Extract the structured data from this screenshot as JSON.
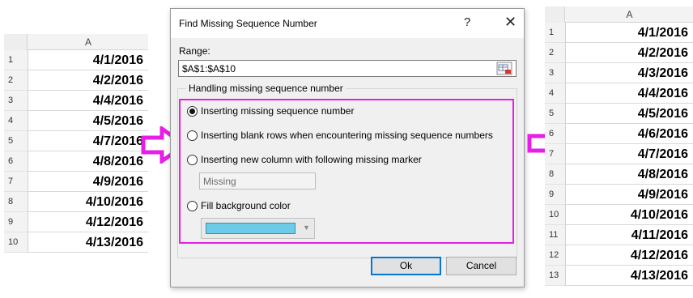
{
  "left_sheet": {
    "column_header": "A",
    "rows": [
      {
        "num": "1",
        "value": "4/1/2016"
      },
      {
        "num": "2",
        "value": "4/2/2016"
      },
      {
        "num": "3",
        "value": "4/4/2016"
      },
      {
        "num": "4",
        "value": "4/5/2016"
      },
      {
        "num": "5",
        "value": "4/7/2016"
      },
      {
        "num": "6",
        "value": "4/8/2016"
      },
      {
        "num": "7",
        "value": "4/9/2016"
      },
      {
        "num": "8",
        "value": "4/10/2016"
      },
      {
        "num": "9",
        "value": "4/12/2016"
      },
      {
        "num": "10",
        "value": "4/13/2016"
      }
    ]
  },
  "right_sheet": {
    "column_header": "A",
    "rows": [
      {
        "num": "1",
        "value": "4/1/2016"
      },
      {
        "num": "2",
        "value": "4/2/2016"
      },
      {
        "num": "3",
        "value": "4/3/2016"
      },
      {
        "num": "4",
        "value": "4/4/2016"
      },
      {
        "num": "5",
        "value": "4/5/2016"
      },
      {
        "num": "6",
        "value": "4/6/2016"
      },
      {
        "num": "7",
        "value": "4/7/2016"
      },
      {
        "num": "8",
        "value": "4/8/2016"
      },
      {
        "num": "9",
        "value": "4/9/2016"
      },
      {
        "num": "10",
        "value": "4/10/2016"
      },
      {
        "num": "11",
        "value": "4/11/2016"
      },
      {
        "num": "12",
        "value": "4/12/2016"
      },
      {
        "num": "13",
        "value": "4/13/2016"
      }
    ]
  },
  "dialog": {
    "title": "Find Missing Sequence Number",
    "help": "?",
    "close": "✕",
    "range_label": "Range:",
    "range_value": "$A$1:$A$10",
    "group_label": "Handling missing sequence number",
    "options": [
      {
        "label": "Inserting missing sequence number",
        "selected": true
      },
      {
        "label": "Inserting blank rows when encountering missing sequence numbers",
        "selected": false
      },
      {
        "label": "Inserting new column with following missing marker",
        "selected": false
      },
      {
        "label": "Fill background color",
        "selected": false
      }
    ],
    "marker_value": "Missing",
    "fill_color": "#6ccbe6",
    "ok_label": "Ok",
    "cancel_label": "Cancel"
  },
  "accent_color": "#e61ee6",
  "icons": {
    "range_picker": "range-select-icon",
    "arrow": "right-arrow-icon"
  }
}
